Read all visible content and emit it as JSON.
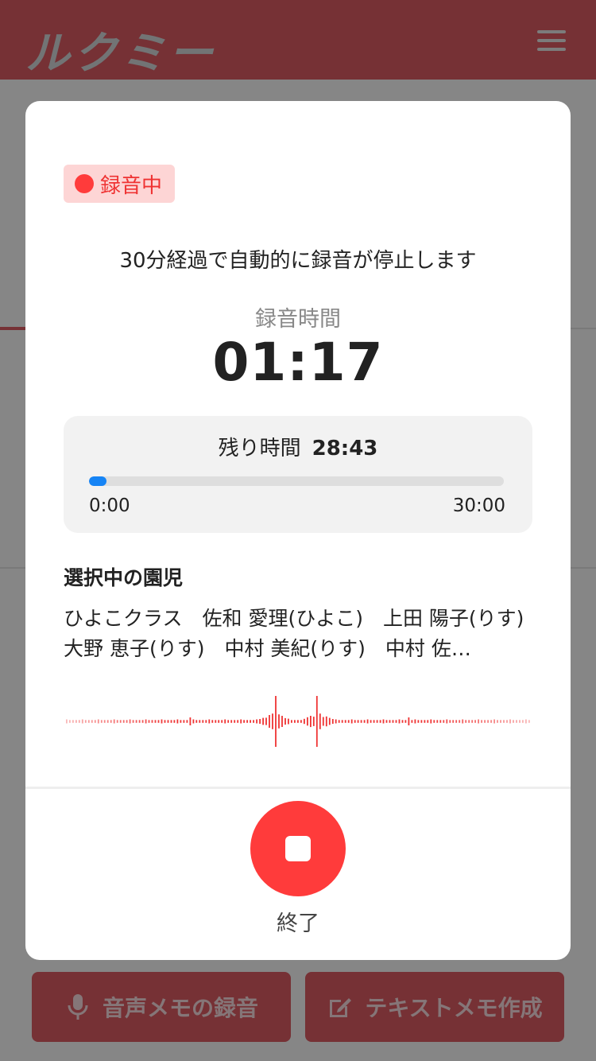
{
  "header": {
    "logo": "ルクミー"
  },
  "bottom_bar": {
    "voice_memo_label": "音声メモの録音",
    "text_memo_label": "テキストメモ作成"
  },
  "modal": {
    "badge_label": "録音中",
    "auto_stop_text": "30分経過で自動的に録音が停止します",
    "time_label": "録音時間",
    "elapsed": "01:17",
    "remaining_label": "残り時間",
    "remaining_value": "28:43",
    "progress_fraction": 0.043,
    "progress_start": "0:00",
    "progress_end": "30:00",
    "selected_title": "選択中の園児",
    "selected_list": "ひよこクラス　佐和 愛理(ひよこ)　上田 陽子(りす)　大野 恵子(りす)　中村 美紀(りす)　中村 佐…",
    "stop_label": "終了"
  },
  "colors": {
    "accent": "#ff3b3b",
    "progress": "#1684f5",
    "header": "#d75961"
  },
  "icons": {
    "record": "record-dot-icon",
    "stop": "stop-square-icon",
    "menu": "hamburger-menu-icon",
    "mic": "microphone-icon",
    "edit": "edit-note-icon"
  }
}
